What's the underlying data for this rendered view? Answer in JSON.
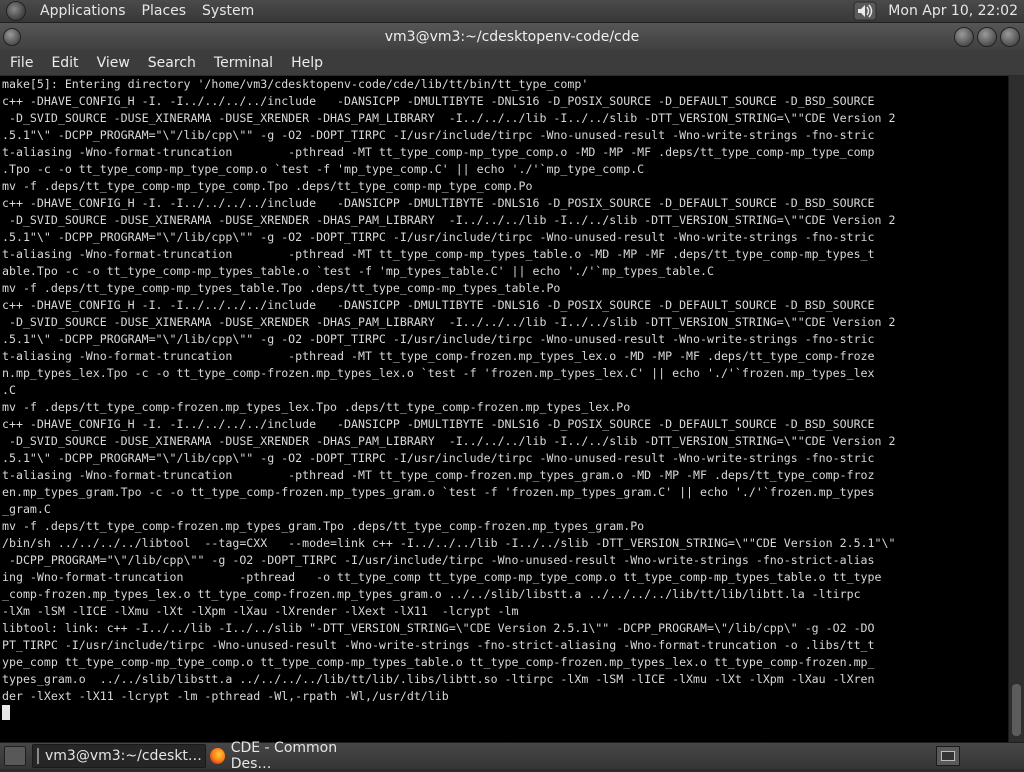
{
  "top_panel": {
    "menus": [
      "Applications",
      "Places",
      "System"
    ],
    "clock": "Mon Apr 10, 22:02",
    "volume_icon": "speaker-volume-icon"
  },
  "window": {
    "title": "vm3@vm3:~/cdesktopenv-code/cde"
  },
  "menubar": {
    "items": [
      "File",
      "Edit",
      "View",
      "Search",
      "Terminal",
      "Help"
    ]
  },
  "terminal": {
    "lines": [
      "make[5]: Entering directory '/home/vm3/cdesktopenv-code/cde/lib/tt/bin/tt_type_comp'",
      "c++ -DHAVE_CONFIG_H -I. -I../../../../include   -DANSICPP -DMULTIBYTE -DNLS16 -D_POSIX_SOURCE -D_DEFAULT_SOURCE -D_BSD_SOURCE",
      " -D_SVID_SOURCE -DUSE_XINERAMA -DUSE_XRENDER -DHAS_PAM_LIBRARY  -I../../../lib -I../../slib -DTT_VERSION_STRING=\\\"\"CDE Version 2",
      ".5.1\"\\\" -DCPP_PROGRAM=\"\\\"/lib/cpp\\\"\" -g -O2 -DOPT_TIRPC -I/usr/include/tirpc -Wno-unused-result -Wno-write-strings -fno-stric",
      "t-aliasing -Wno-format-truncation        -pthread -MT tt_type_comp-mp_type_comp.o -MD -MP -MF .deps/tt_type_comp-mp_type_comp",
      ".Tpo -c -o tt_type_comp-mp_type_comp.o `test -f 'mp_type_comp.C' || echo './'`mp_type_comp.C",
      "mv -f .deps/tt_type_comp-mp_type_comp.Tpo .deps/tt_type_comp-mp_type_comp.Po",
      "c++ -DHAVE_CONFIG_H -I. -I../../../../include   -DANSICPP -DMULTIBYTE -DNLS16 -D_POSIX_SOURCE -D_DEFAULT_SOURCE -D_BSD_SOURCE",
      " -D_SVID_SOURCE -DUSE_XINERAMA -DUSE_XRENDER -DHAS_PAM_LIBRARY  -I../../../lib -I../../slib -DTT_VERSION_STRING=\\\"\"CDE Version 2",
      ".5.1\"\\\" -DCPP_PROGRAM=\"\\\"/lib/cpp\\\"\" -g -O2 -DOPT_TIRPC -I/usr/include/tirpc -Wno-unused-result -Wno-write-strings -fno-stric",
      "t-aliasing -Wno-format-truncation        -pthread -MT tt_type_comp-mp_types_table.o -MD -MP -MF .deps/tt_type_comp-mp_types_t",
      "able.Tpo -c -o tt_type_comp-mp_types_table.o `test -f 'mp_types_table.C' || echo './'`mp_types_table.C",
      "mv -f .deps/tt_type_comp-mp_types_table.Tpo .deps/tt_type_comp-mp_types_table.Po",
      "c++ -DHAVE_CONFIG_H -I. -I../../../../include   -DANSICPP -DMULTIBYTE -DNLS16 -D_POSIX_SOURCE -D_DEFAULT_SOURCE -D_BSD_SOURCE",
      " -D_SVID_SOURCE -DUSE_XINERAMA -DUSE_XRENDER -DHAS_PAM_LIBRARY  -I../../../lib -I../../slib -DTT_VERSION_STRING=\\\"\"CDE Version 2",
      ".5.1\"\\\" -DCPP_PROGRAM=\"\\\"/lib/cpp\\\"\" -g -O2 -DOPT_TIRPC -I/usr/include/tirpc -Wno-unused-result -Wno-write-strings -fno-stric",
      "t-aliasing -Wno-format-truncation        -pthread -MT tt_type_comp-frozen.mp_types_lex.o -MD -MP -MF .deps/tt_type_comp-froze",
      "n.mp_types_lex.Tpo -c -o tt_type_comp-frozen.mp_types_lex.o `test -f 'frozen.mp_types_lex.C' || echo './'`frozen.mp_types_lex",
      ".C",
      "mv -f .deps/tt_type_comp-frozen.mp_types_lex.Tpo .deps/tt_type_comp-frozen.mp_types_lex.Po",
      "c++ -DHAVE_CONFIG_H -I. -I../../../../include   -DANSICPP -DMULTIBYTE -DNLS16 -D_POSIX_SOURCE -D_DEFAULT_SOURCE -D_BSD_SOURCE",
      " -D_SVID_SOURCE -DUSE_XINERAMA -DUSE_XRENDER -DHAS_PAM_LIBRARY  -I../../../lib -I../../slib -DTT_VERSION_STRING=\\\"\"CDE Version 2",
      ".5.1\"\\\" -DCPP_PROGRAM=\"\\\"/lib/cpp\\\"\" -g -O2 -DOPT_TIRPC -I/usr/include/tirpc -Wno-unused-result -Wno-write-strings -fno-stric",
      "t-aliasing -Wno-format-truncation        -pthread -MT tt_type_comp-frozen.mp_types_gram.o -MD -MP -MF .deps/tt_type_comp-froz",
      "en.mp_types_gram.Tpo -c -o tt_type_comp-frozen.mp_types_gram.o `test -f 'frozen.mp_types_gram.C' || echo './'`frozen.mp_types",
      "_gram.C",
      "mv -f .deps/tt_type_comp-frozen.mp_types_gram.Tpo .deps/tt_type_comp-frozen.mp_types_gram.Po",
      "/bin/sh ../../../../libtool  --tag=CXX   --mode=link c++ -I../../../lib -I../../slib -DTT_VERSION_STRING=\\\"\"CDE Version 2.5.1\"\\\"",
      " -DCPP_PROGRAM=\"\\\"/lib/cpp\\\"\" -g -O2 -DOPT_TIRPC -I/usr/include/tirpc -Wno-unused-result -Wno-write-strings -fno-strict-alias",
      "ing -Wno-format-truncation        -pthread   -o tt_type_comp tt_type_comp-mp_type_comp.o tt_type_comp-mp_types_table.o tt_type",
      "_comp-frozen.mp_types_lex.o tt_type_comp-frozen.mp_types_gram.o ../../slib/libstt.a ../../../../lib/tt/lib/libtt.la -ltirpc",
      "-lXm -lSM -lICE -lXmu -lXt -lXpm -lXau -lXrender -lXext -lX11  -lcrypt -lm",
      "libtool: link: c++ -I../../lib -I../../slib \"-DTT_VERSION_STRING=\\\"CDE Version 2.5.1\\\"\" -DCPP_PROGRAM=\\\"/lib/cpp\\\" -g -O2 -DO",
      "PT_TIRPC -I/usr/include/tirpc -Wno-unused-result -Wno-write-strings -fno-strict-aliasing -Wno-format-truncation -o .libs/tt_t",
      "ype_comp tt_type_comp-mp_type_comp.o tt_type_comp-mp_types_table.o tt_type_comp-frozen.mp_types_lex.o tt_type_comp-frozen.mp_",
      "types_gram.o  ../../slib/libstt.a ../../../../lib/tt/lib/.libs/libtt.so -ltirpc -lXm -lSM -lICE -lXmu -lXt -lXpm -lXau -lXren",
      "der -lXext -lX11 -lcrypt -lm -pthread -Wl,-rpath -Wl,/usr/dt/lib"
    ]
  },
  "taskbar": {
    "tasks": [
      {
        "label": "vm3@vm3:~/cdeskt…",
        "icon": "terminal-icon",
        "active": true
      },
      {
        "label": "CDE - Common Des…",
        "icon": "firefox-icon",
        "active": false
      }
    ],
    "workspace_icon": "workspace-switcher-icon"
  }
}
